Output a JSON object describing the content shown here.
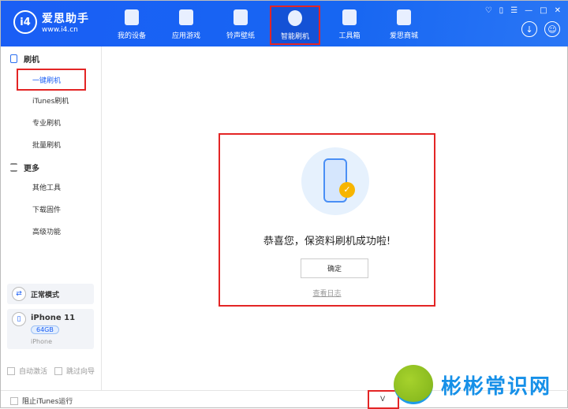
{
  "app": {
    "name": "爱思助手",
    "url": "www.i4.cn",
    "logo_mark": "i4"
  },
  "nav": [
    {
      "label": "我的设备",
      "icon": "phone-icon"
    },
    {
      "label": "应用游戏",
      "icon": "cube-icon"
    },
    {
      "label": "铃声壁纸",
      "icon": "music-folder-icon"
    },
    {
      "label": "智能刷机",
      "icon": "shield-refresh-icon",
      "active": true
    },
    {
      "label": "工具箱",
      "icon": "toolbox-icon"
    },
    {
      "label": "爱思商城",
      "icon": "shopping-bag-icon"
    }
  ],
  "window_controls": [
    "shirt-icon",
    "note-icon",
    "menu-icon",
    "minimize-icon",
    "maximize-icon",
    "close-icon"
  ],
  "sidebar": {
    "section1": "刷机",
    "items1": [
      "一键刷机",
      "iTunes刷机",
      "专业刷机",
      "批量刷机"
    ],
    "section2": "更多",
    "items2": [
      "其他工具",
      "下载固件",
      "高级功能"
    ],
    "mode": "正常模式",
    "device": {
      "name": "iPhone 11",
      "storage": "64GB",
      "type": "iPhone"
    },
    "auto_activate": "自动激活",
    "skip_guide": "跳过向导"
  },
  "bottom": {
    "block_itunes": "阻止iTunes运行",
    "version": "V"
  },
  "dialog": {
    "message": "恭喜您，保资料刷机成功啦!",
    "ok": "确定",
    "view_log": "查看日志"
  },
  "watermark": "彬彬常识网",
  "colors": {
    "brand": "#1a5ef5",
    "highlight": "#e32525"
  }
}
